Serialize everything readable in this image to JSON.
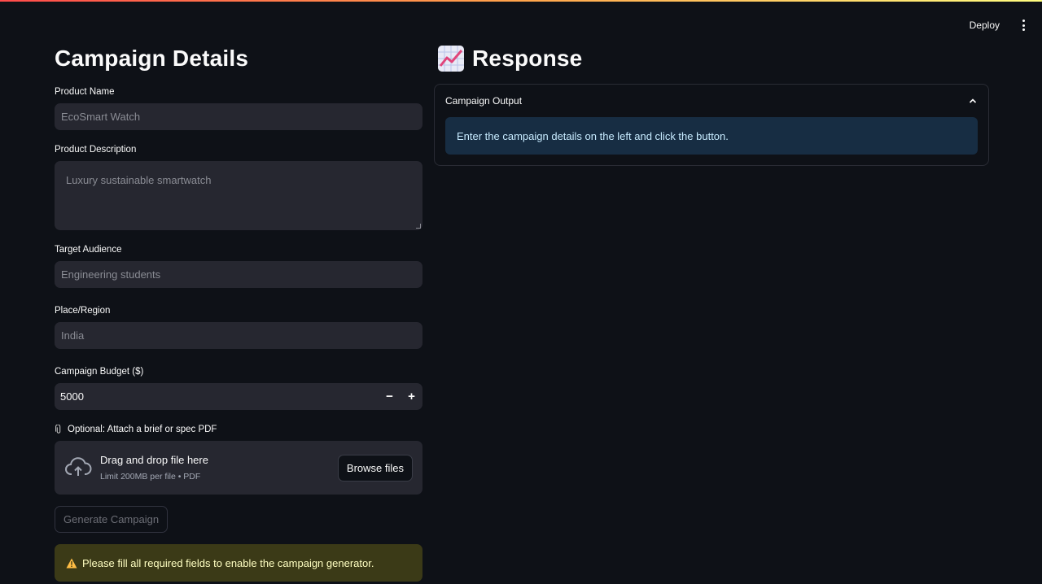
{
  "header": {
    "deploy_label": "Deploy",
    "menu_icon": "kebab-icon"
  },
  "left": {
    "title": "Campaign Details",
    "product_name": {
      "label": "Product Name",
      "placeholder": "EcoSmart Watch",
      "value": ""
    },
    "product_description": {
      "label": "Product Description",
      "placeholder": "Luxury sustainable smartwatch",
      "value": ""
    },
    "target_audience": {
      "label": "Target Audience",
      "placeholder": "Engineering students",
      "value": ""
    },
    "place_region": {
      "label": "Place/Region",
      "placeholder": "India",
      "value": ""
    },
    "budget": {
      "label": "Campaign Budget ($)",
      "value": "5000",
      "minus": "−",
      "plus": "+"
    },
    "upload": {
      "label": "Optional: Attach a brief or spec PDF",
      "drop_text": "Drag and drop file here",
      "limit_text": "Limit 200MB per file • PDF",
      "browse_label": "Browse files"
    },
    "generate_label": "Generate Campaign",
    "warning_text": "Please fill all required fields to enable the campaign generator."
  },
  "right": {
    "title": "Response",
    "expander_title": "Campaign Output",
    "info_text": "Enter the campaign details on the left and click the button."
  },
  "colors": {
    "background": "#0e1117",
    "input_bg": "#262730",
    "warning_bg": "#3b3a17",
    "info_bg": "#172d43"
  }
}
